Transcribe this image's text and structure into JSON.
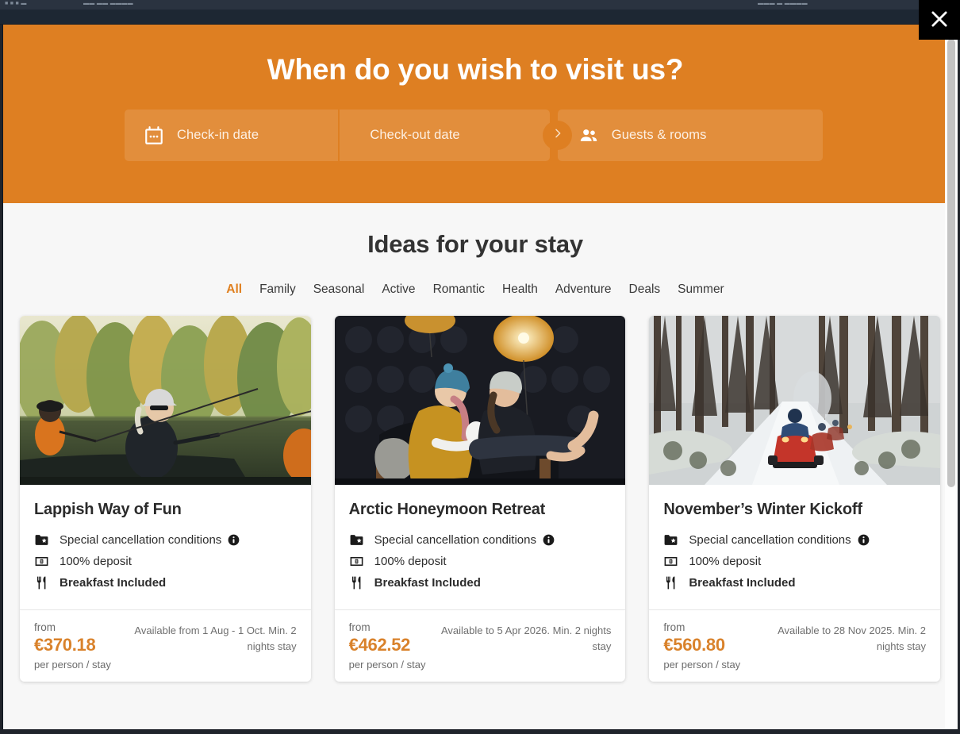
{
  "browser": {
    "ghost_left": "■ ■ ■   ▬",
    "ghost_mid": "▬▬  ▬▬ ▬▬▬▬",
    "ghost_right": "▬▬▬  ▬ ▬▬▬▬"
  },
  "modal": {
    "close_label": "×"
  },
  "hero": {
    "title": "When do you wish to visit us?",
    "fields": [
      {
        "label": "Check-in date",
        "icon": "calendar-icon"
      },
      {
        "label": "Check-out date",
        "icon": "none"
      },
      {
        "label": "Guests & rooms",
        "icon": "people-icon"
      }
    ],
    "separator_icon": "chevron-right-icon",
    "accent_color": "#de7f22"
  },
  "ideas": {
    "title": "Ideas for your stay",
    "filters": [
      {
        "label": "All",
        "active": true
      },
      {
        "label": "Family",
        "active": false
      },
      {
        "label": "Seasonal",
        "active": false
      },
      {
        "label": "Active",
        "active": false
      },
      {
        "label": "Romantic",
        "active": false
      },
      {
        "label": "Health",
        "active": false
      },
      {
        "label": "Adventure",
        "active": false
      },
      {
        "label": "Deals",
        "active": false
      },
      {
        "label": "Summer",
        "active": false
      }
    ],
    "active_color": "#e08020",
    "cards": [
      {
        "title": "Lappish Way of Fun",
        "photo_alt": "people-fishing-from-boat-on-autumn-lake",
        "features": [
          {
            "icon": "folder-star-icon",
            "text": "Special cancellation conditions",
            "bold": false,
            "info": true
          },
          {
            "icon": "banknote-icon",
            "text": "100% deposit",
            "bold": false,
            "info": false
          },
          {
            "icon": "cutlery-icon",
            "text": "Breakfast Included",
            "bold": true,
            "info": false
          }
        ],
        "from_label": "from",
        "price": "€370.18",
        "per_label": "per person / stay",
        "availability": "Available from 1 Aug - 1 Oct. Min. 2 nights stay"
      },
      {
        "title": "Arctic Honeymoon Retreat",
        "photo_alt": "couple-in-beanies-under-warm-lamps",
        "features": [
          {
            "icon": "folder-star-icon",
            "text": "Special cancellation conditions",
            "bold": false,
            "info": true
          },
          {
            "icon": "banknote-icon",
            "text": "100% deposit",
            "bold": false,
            "info": false
          },
          {
            "icon": "cutlery-icon",
            "text": "Breakfast Included",
            "bold": true,
            "info": false
          }
        ],
        "from_label": "from",
        "price": "€462.52",
        "per_label": "per person / stay",
        "availability": "Available to 5 Apr 2026. Min. 2 nights stay"
      },
      {
        "title": "November’s Winter Kickoff",
        "photo_alt": "snowmobiles-on-snowy-forest-track",
        "features": [
          {
            "icon": "folder-star-icon",
            "text": "Special cancellation conditions",
            "bold": false,
            "info": true
          },
          {
            "icon": "banknote-icon",
            "text": "100% deposit",
            "bold": false,
            "info": false
          },
          {
            "icon": "cutlery-icon",
            "text": "Breakfast Included",
            "bold": true,
            "info": false
          }
        ],
        "from_label": "from",
        "price": "€560.80",
        "per_label": "per person / stay",
        "availability": "Available to 28 Nov 2025. Min. 2 nights stay"
      }
    ]
  }
}
